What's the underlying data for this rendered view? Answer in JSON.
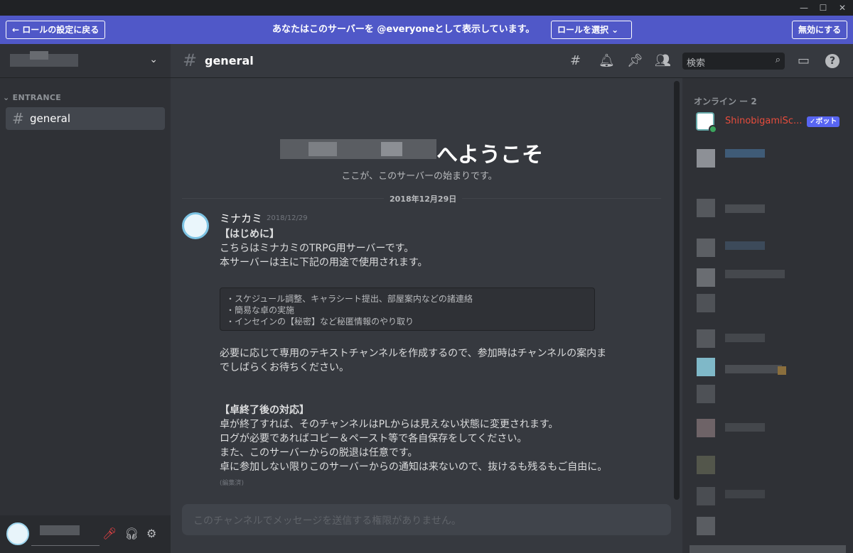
{
  "window": {
    "minimize": "—",
    "maximize": "☐",
    "close": "✕"
  },
  "banner": {
    "back_label": "← ロールの設定に戻る",
    "message": "あなたはこのサーバーを @everyoneとして表示しています。",
    "role_select_label": "ロールを選択 ⌄",
    "disable_label": "無効にする"
  },
  "sidebar": {
    "category": "ENTRANCE",
    "channels": [
      {
        "name": "general"
      }
    ]
  },
  "channel": {
    "name": "general",
    "search_placeholder": "検索"
  },
  "welcome": {
    "title": "へようこそ",
    "subtitle": "ここが、このサーバーの始まりです。"
  },
  "divider_date": "2018年12月29日",
  "message": {
    "author": "ミナカミ",
    "timestamp": "2018/12/29",
    "lines": [
      "【はじめに】",
      "こちらはミナカミのTRPG用サーバーです。",
      "本サーバーは主に下記の用途で使用されます。"
    ],
    "code_lines": [
      "・スケジュール調整、キャラシート提出、部屋案内などの諸連絡",
      "・簡易な卓の実施",
      "・インセインの【秘密】など秘匿情報のやり取り"
    ],
    "para2": [
      "必要に応じて専用のテキストチャンネルを作成するので、参加時はチャンネルの案内ま",
      "でしばらくお待ちください。"
    ],
    "para3_title": "【卓終了後の対応】",
    "para3": [
      "卓が終了すれば、そのチャンネルはPLからは見えない状態に変更されます。",
      "ログが必要であればコピー＆ペースト等で各自保存をしてください。",
      "また、このサーバーからの脱退は任意です。",
      "卓に参加しない限りこのサーバーからの通知は来ないので、抜けるも残るもご自由に。"
    ],
    "edited": "(編集済)"
  },
  "input": {
    "placeholder": "このチャンネルでメッセージを送信する権限がありません。"
  },
  "members": {
    "header": "オンライン ー 2",
    "bot_name": "ShinobigamiSc...",
    "bot_badge": "✓ボット"
  },
  "colors": {
    "banner": "#5058c8",
    "bot_name": "#e74c3c",
    "online": "#3ba55d"
  }
}
